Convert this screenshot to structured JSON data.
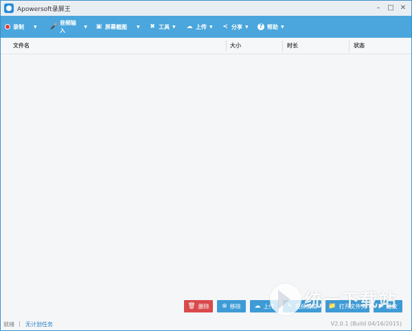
{
  "window": {
    "title": "Apowersoft录屏王"
  },
  "toolbar": {
    "items": [
      {
        "label": "录制",
        "icon": "record-dot-icon"
      },
      {
        "label": "音频输入",
        "icon": "microphone-icon"
      },
      {
        "label": "屏幕截图",
        "icon": "camera-icon"
      },
      {
        "label": "工具",
        "icon": "tools-icon"
      },
      {
        "label": "上传",
        "icon": "cloud-upload-icon"
      },
      {
        "label": "分享",
        "icon": "share-icon"
      },
      {
        "label": "帮助",
        "icon": "help-icon"
      }
    ]
  },
  "list": {
    "columns": [
      "文件名",
      "大小",
      "时长",
      "状态"
    ]
  },
  "actions": {
    "delete": "删除",
    "remove": "移除",
    "upload": "上传",
    "convert": "视频编辑",
    "open_folder": "打开文件夹",
    "play": "播放"
  },
  "status": {
    "state": "就绪",
    "divider": "|",
    "plan_link": "无计划任务",
    "version": "V2.0.1 (Build 04/16/2015)"
  },
  "watermark": {
    "text": "统一下载站"
  },
  "colors": {
    "toolbar": "#4aa6dc",
    "delete": "#d9494a",
    "action": "#3d9bd6",
    "record": "#e13b3b"
  }
}
